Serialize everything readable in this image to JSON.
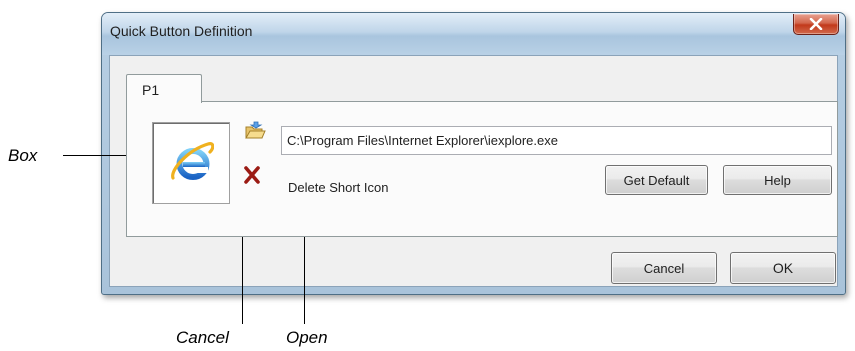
{
  "window": {
    "title": "Quick Button Definition",
    "close_icon": "close-x-icon",
    "titlebar_color": "#b9d1e6",
    "close_color": "#c2391b"
  },
  "tabs": [
    {
      "label": "P1",
      "selected": true
    }
  ],
  "panel": {
    "icon_box_icon": "internet-explorer-icon",
    "open_icon": "open-folder-icon",
    "delete_icon": "red-x-icon",
    "path_value": "C:\\Program Files\\Internet Explorer\\iexplore.exe",
    "delete_label": "Delete Short Icon",
    "get_default_label": "Get Default",
    "help_label": "Help"
  },
  "footer": {
    "cancel_label": "Cancel",
    "ok_label": "OK"
  },
  "annotations": {
    "box": "Box",
    "cancel": "Cancel",
    "open": "Open"
  }
}
